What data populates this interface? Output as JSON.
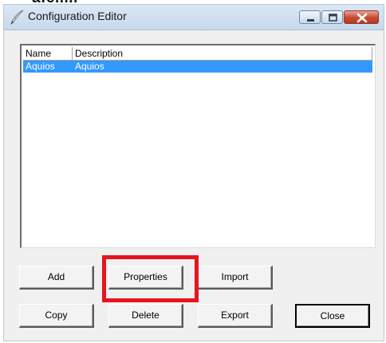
{
  "window": {
    "title": "Configuration Editor"
  },
  "list": {
    "columns": [
      "Name",
      "Description"
    ],
    "rows": [
      {
        "name": "Aquios",
        "description": "Aquios",
        "selected": true
      }
    ]
  },
  "buttons": {
    "add": "Add",
    "properties": "Properties",
    "import": "Import",
    "copy": "Copy",
    "delete": "Delete",
    "export": "Export",
    "close": "Close"
  },
  "icons": {
    "app": "quill-pen-icon",
    "minimize": "minimize-icon",
    "maximize": "maximize-icon",
    "close": "close-icon"
  },
  "colors": {
    "selection": "#3399ff",
    "highlight": "#e8141f",
    "close_button": "#c74a31"
  }
}
